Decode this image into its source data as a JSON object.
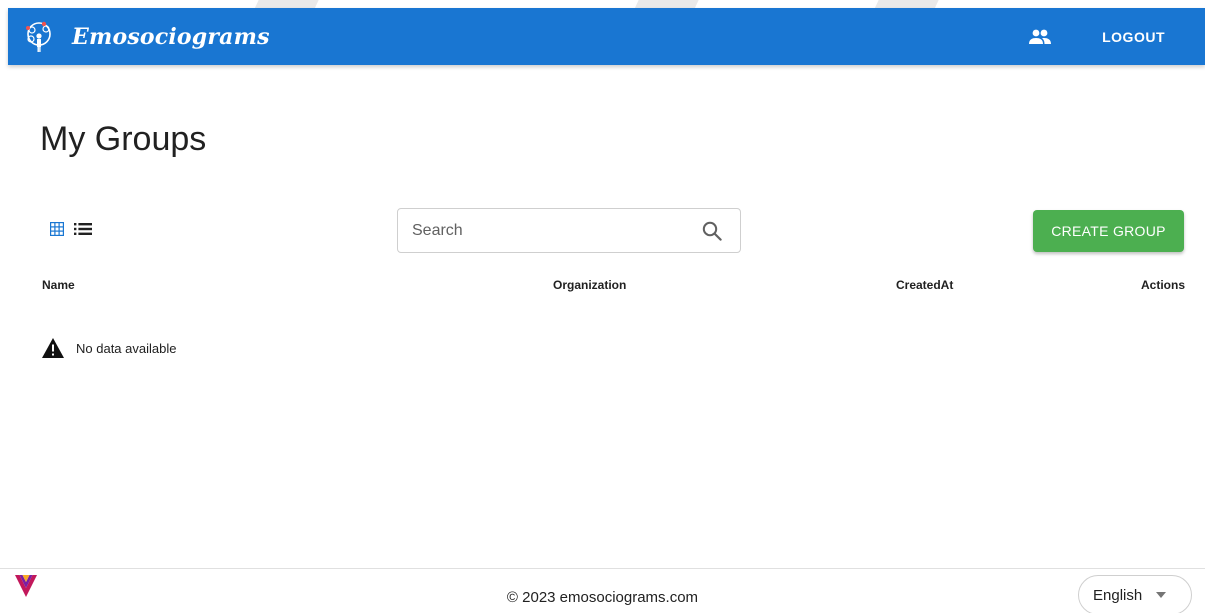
{
  "header": {
    "brand_name": "Emosociograms",
    "logout_label": "LOGOUT",
    "brand_color": "#1976d2",
    "icons": {
      "logo": "emosociograms-logo-icon",
      "groups": "groups-icon"
    }
  },
  "page": {
    "title": "My Groups"
  },
  "toolbar": {
    "view_icons": [
      "grid-view-icon",
      "list-view-icon"
    ],
    "search": {
      "placeholder": "Search",
      "value": "",
      "icon": "search-icon"
    },
    "create_label": "CREATE GROUP",
    "create_color": "#4caf50"
  },
  "table": {
    "columns": [
      "Name",
      "Organization",
      "CreatedAt",
      "Actions"
    ],
    "rows": [],
    "empty_message": "No data available",
    "empty_icon": "warning-icon"
  },
  "footer": {
    "copyright": "© 2023 emosociograms.com",
    "language": "English",
    "logo_icon": "partner-logo-icon"
  }
}
